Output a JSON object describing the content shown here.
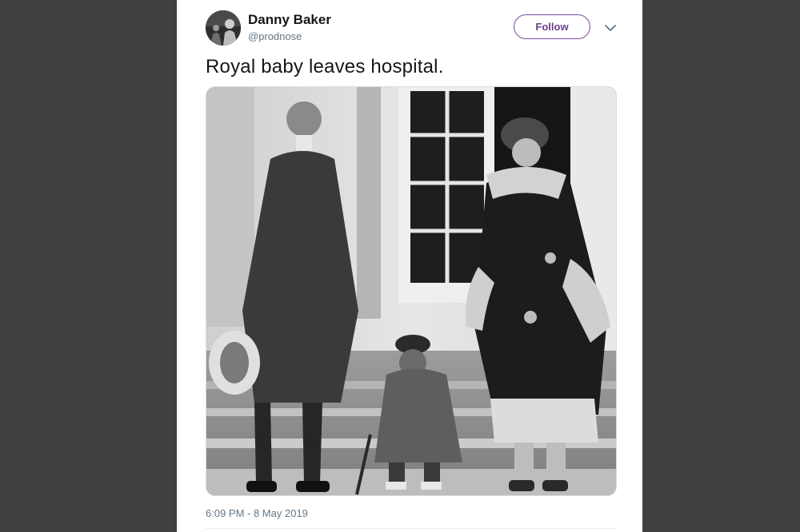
{
  "tweet": {
    "author_name": "Danny Baker",
    "author_handle": "@prodnose",
    "follow_label": "Follow",
    "text": "Royal baby leaves hospital.",
    "timestamp": "6:09 PM - 8 May 2019"
  },
  "photo": {
    "description": "black-and-white photo"
  },
  "icons": {
    "menu": "chevron-down-icon",
    "avatar": "user-avatar"
  },
  "colors": {
    "backdrop": "#414141",
    "card": "#ffffff",
    "follow_accent": "#6b3f8c",
    "secondary_text": "#657786",
    "primary_text": "#14171a"
  }
}
